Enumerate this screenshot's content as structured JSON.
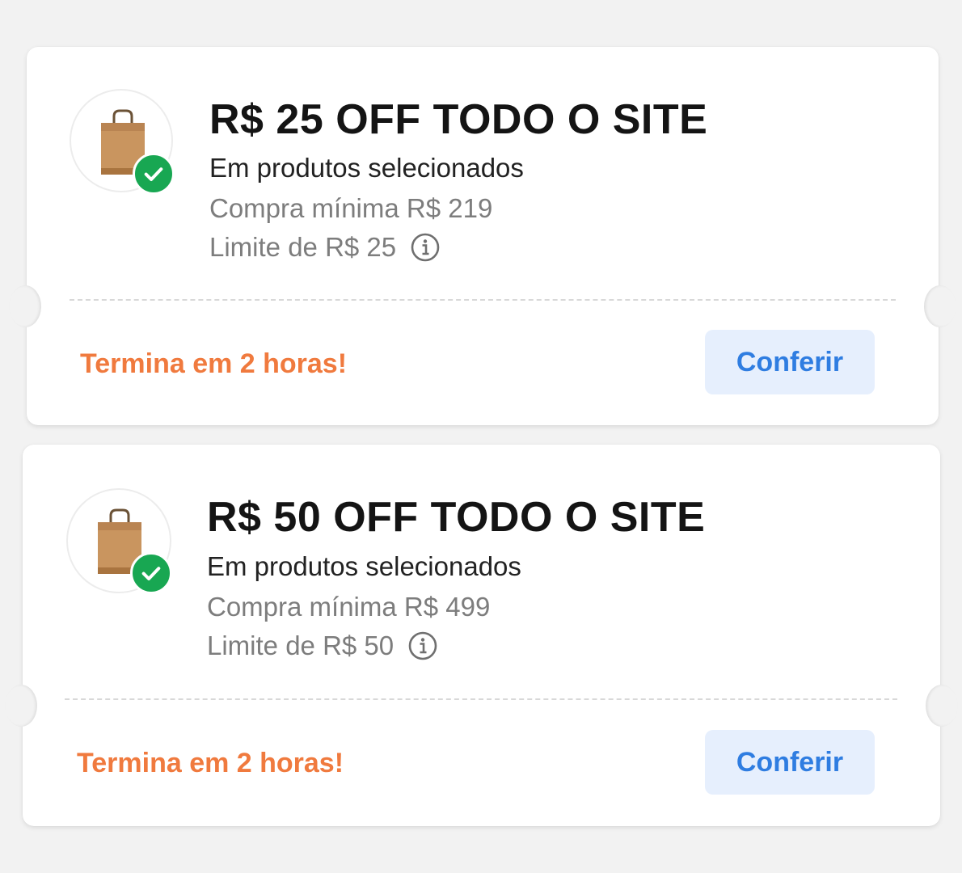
{
  "coupons": [
    {
      "title": "R$ 25 OFF TODO O SITE",
      "subtitle": "Em produtos selecionados",
      "min_purchase": "Compra mínima R$ 219",
      "limit": "Limite de R$ 25",
      "expires": "Termina em 2 horas!",
      "button_label": "Conferir",
      "icon": "shopping-bag-icon",
      "badge_icon": "check-icon"
    },
    {
      "title": "R$ 50 OFF TODO O SITE",
      "subtitle": "Em produtos selecionados",
      "min_purchase": "Compra mínima R$ 499",
      "limit": "Limite de R$ 50",
      "expires": "Termina em 2 horas!",
      "button_label": "Conferir",
      "icon": "shopping-bag-icon",
      "badge_icon": "check-icon"
    }
  ],
  "colors": {
    "accent_orange": "#f07a3e",
    "button_text": "#2f7de1",
    "button_bg": "#e6effd",
    "check_green": "#18a752"
  }
}
